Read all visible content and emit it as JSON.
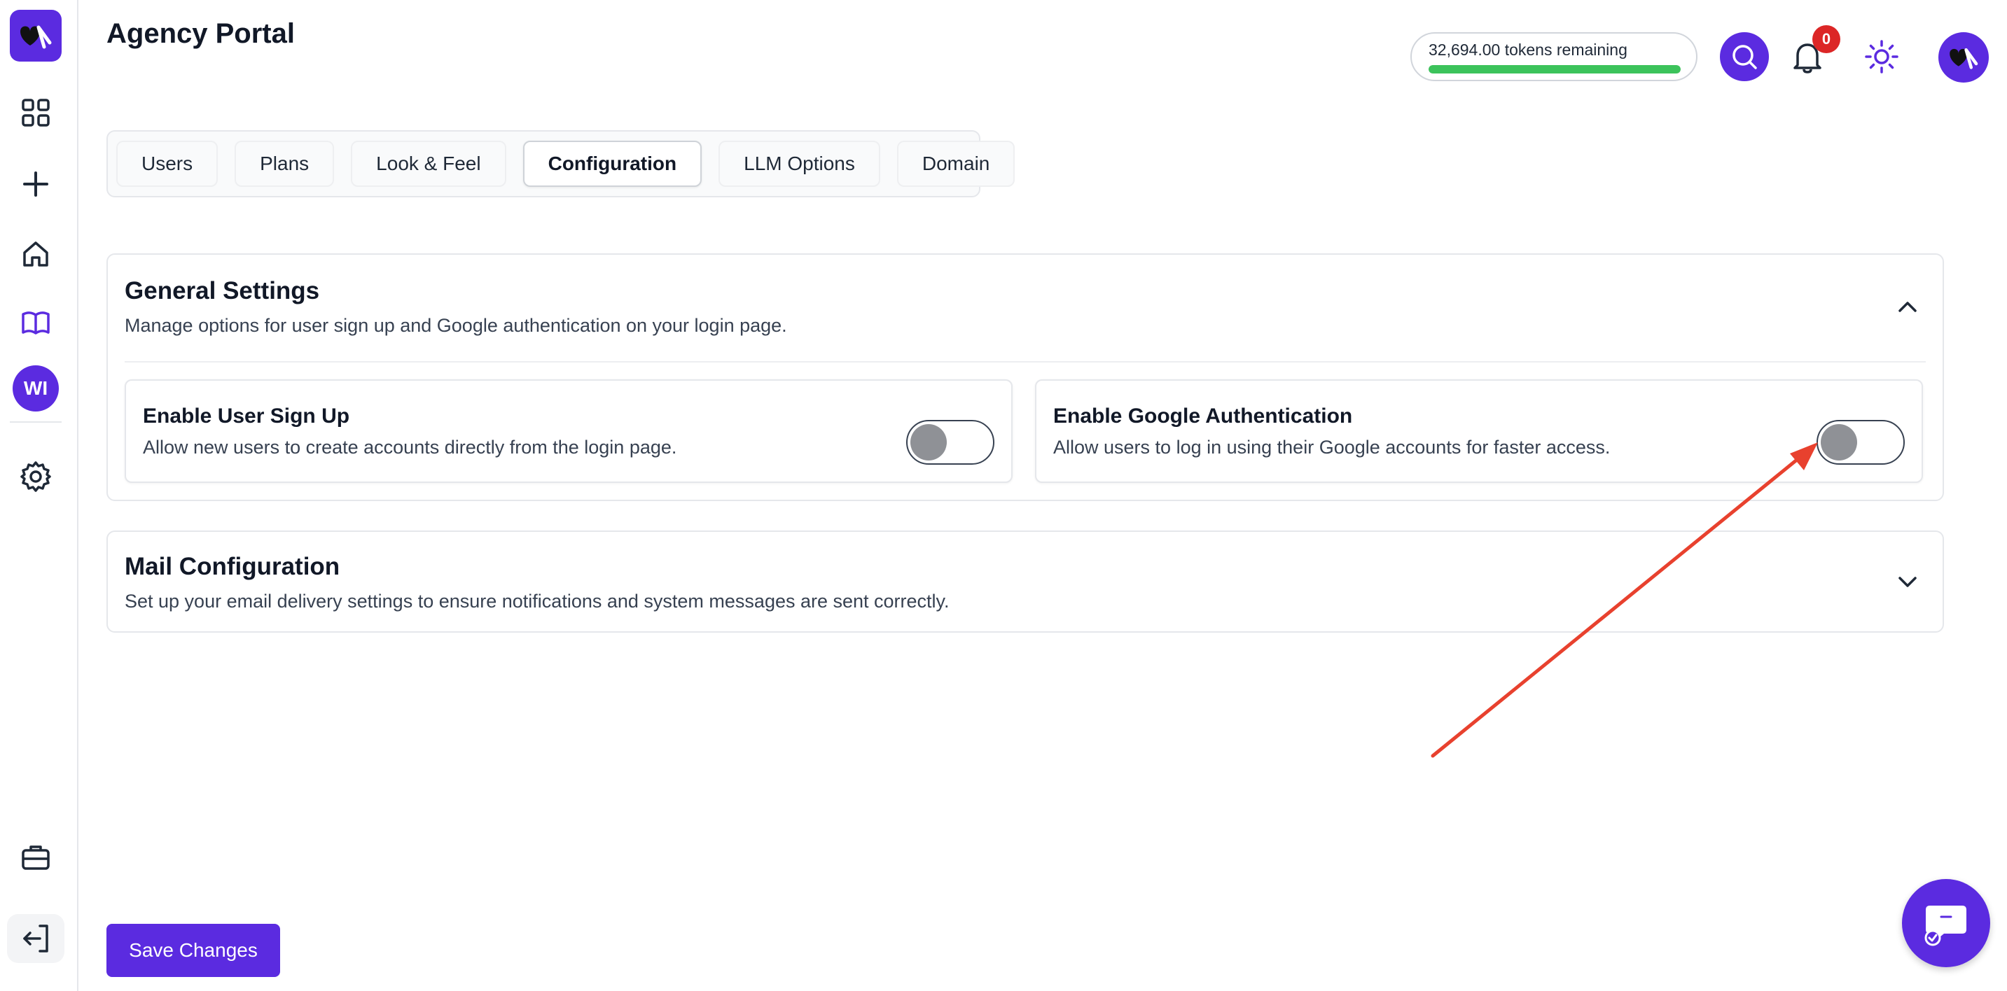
{
  "app": {
    "page_title": "Agency Portal",
    "brand_color": "#5b2be0"
  },
  "sidebar": {
    "logo": "brand-logo",
    "items": [
      {
        "name": "dashboard",
        "icon": "grid-icon"
      },
      {
        "name": "create",
        "icon": "plus-icon"
      },
      {
        "name": "home",
        "icon": "home-icon"
      },
      {
        "name": "library",
        "icon": "book-icon"
      },
      {
        "name": "workspace",
        "avatar_text": "WI"
      },
      {
        "name": "settings",
        "icon": "gear-icon"
      },
      {
        "name": "portfolio",
        "icon": "briefcase-icon"
      },
      {
        "name": "logout",
        "icon": "logout-icon"
      }
    ]
  },
  "header": {
    "tokens_text": "32,694.00 tokens remaining",
    "tokens_fraction": 1.0,
    "tokens_color": "#3cc35b",
    "notifications_count": "0"
  },
  "tabs": [
    {
      "label": "Users",
      "active": false
    },
    {
      "label": "Plans",
      "active": false
    },
    {
      "label": "Look & Feel",
      "active": false
    },
    {
      "label": "Configuration",
      "active": true
    },
    {
      "label": "LLM Options",
      "active": false
    },
    {
      "label": "Domain",
      "active": false
    }
  ],
  "general": {
    "title": "General Settings",
    "description": "Manage options for user sign up and Google authentication on your login page.",
    "expanded": true,
    "options": [
      {
        "title": "Enable User Sign Up",
        "description": "Allow new users to create accounts directly from the login page.",
        "enabled": false
      },
      {
        "title": "Enable Google Authentication",
        "description": "Allow users to log in using their Google accounts for faster access.",
        "enabled": false
      }
    ]
  },
  "mail": {
    "title": "Mail Configuration",
    "description": "Set up your email delivery settings to ensure notifications and system messages are sent correctly.",
    "expanded": false
  },
  "actions": {
    "save_label": "Save Changes"
  },
  "annotation": {
    "color": "#e8412e"
  }
}
